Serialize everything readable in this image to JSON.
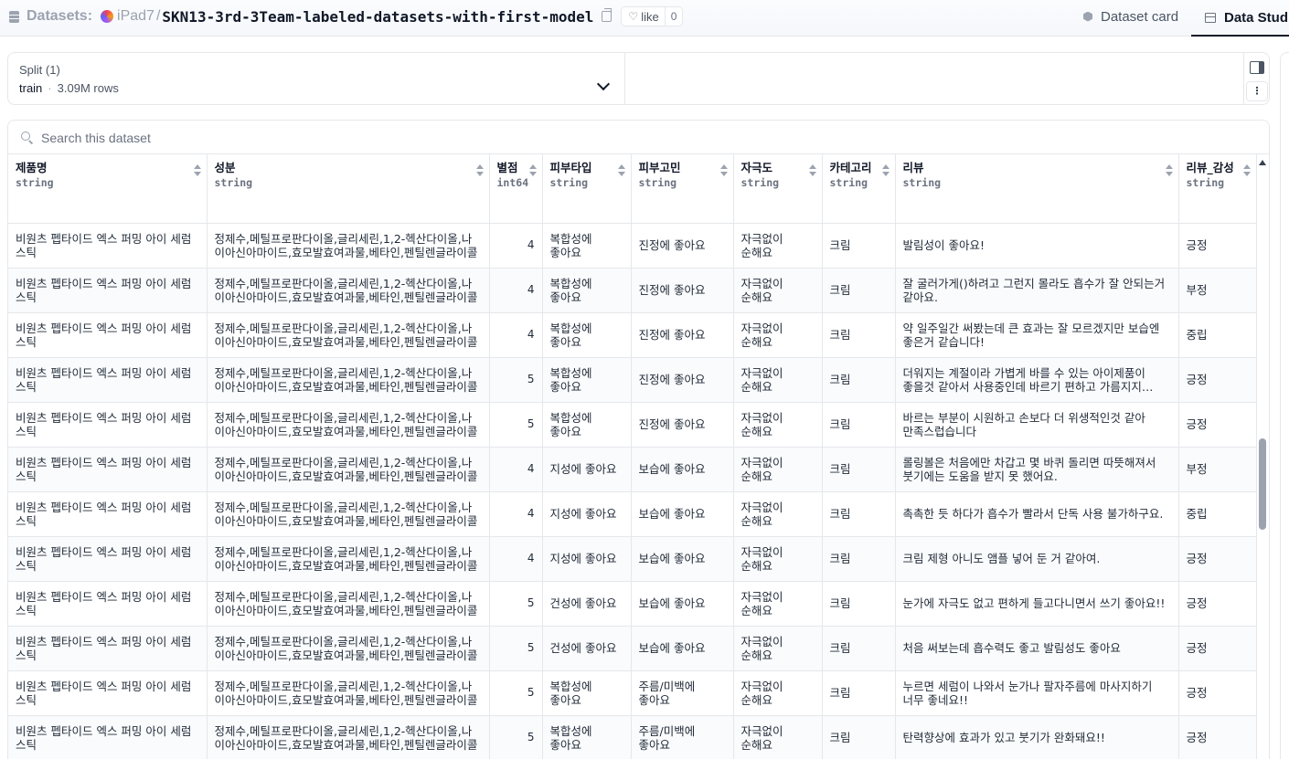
{
  "header": {
    "section": "Datasets:",
    "owner": "iPad7",
    "separator": "/",
    "repo": "SKN13-3rd-3Team-labeled-datasets-with-first-model",
    "like_label": "like",
    "like_count": "0",
    "tabs": [
      "Dataset card",
      "Data Studio"
    ]
  },
  "split": {
    "title": "Split (1)",
    "value": "train",
    "dot": "·",
    "rows": "3.09M rows"
  },
  "search": {
    "placeholder": "Search this dataset"
  },
  "table": {
    "columns": [
      {
        "name": "제품명",
        "type": "string"
      },
      {
        "name": "성분",
        "type": "string"
      },
      {
        "name": "별점",
        "type": "int64"
      },
      {
        "name": "피부타입",
        "type": "string"
      },
      {
        "name": "피부고민",
        "type": "string"
      },
      {
        "name": "자극도",
        "type": "string"
      },
      {
        "name": "카테고리",
        "type": "string"
      },
      {
        "name": "리뷰",
        "type": "string"
      },
      {
        "name": "리뷰_감성",
        "type": "string"
      }
    ],
    "rows": [
      [
        "비원츠 펩타이드 엑스 퍼밍 아이 세럼 스틱",
        "정제수,메틸프로판다이올,글리세린,1,2-헥산다이올,나이아신아마이드,효모발효여과물,베타인,펜틸렌글라이콜",
        "4",
        "복합성에 좋아요",
        "진정에 좋아요",
        "자극없이 순해요",
        "크림",
        "발림성이 좋아요!",
        "긍정"
      ],
      [
        "비원츠 펩타이드 엑스 퍼밍 아이 세럼 스틱",
        "정제수,메틸프로판다이올,글리세린,1,2-헥산다이올,나이아신아마이드,효모발효여과물,베타인,펜틸렌글라이콜",
        "4",
        "복합성에 좋아요",
        "진정에 좋아요",
        "자극없이 순해요",
        "크림",
        "잘 굴러가게()하려고 그런지 몰라도 흡수가 잘 안되는거 같아요.",
        "부정"
      ],
      [
        "비원츠 펩타이드 엑스 퍼밍 아이 세럼 스틱",
        "정제수,메틸프로판다이올,글리세린,1,2-헥산다이올,나이아신아마이드,효모발효여과물,베타인,펜틸렌글라이콜",
        "4",
        "복합성에 좋아요",
        "진정에 좋아요",
        "자극없이 순해요",
        "크림",
        "약 일주일간 써봤는데 큰 효과는 잘 모르겠지만 보습엔 좋은거 같습니다!",
        "중립"
      ],
      [
        "비원츠 펩타이드 엑스 퍼밍 아이 세럼 스틱",
        "정제수,메틸프로판다이올,글리세린,1,2-헥산다이올,나이아신아마이드,효모발효여과물,베타인,펜틸렌글라이콜",
        "5",
        "복합성에 좋아요",
        "진정에 좋아요",
        "자극없이 순해요",
        "크림",
        "더워지는 계절이라 가볍게 바를 수 있는 아이제품이 좋을것 같아서 사용중인데 바르기 편하고 가름지지 않아서 좋아요",
        "긍정"
      ],
      [
        "비원츠 펩타이드 엑스 퍼밍 아이 세럼 스틱",
        "정제수,메틸프로판다이올,글리세린,1,2-헥산다이올,나이아신아마이드,효모발효여과물,베타인,펜틸렌글라이콜",
        "5",
        "복합성에 좋아요",
        "진정에 좋아요",
        "자극없이 순해요",
        "크림",
        "바르는 부분이 시원하고 손보다 더 위생적인것 같아 만족스럽습니다",
        "긍정"
      ],
      [
        "비원츠 펩타이드 엑스 퍼밍 아이 세럼 스틱",
        "정제수,메틸프로판다이올,글리세린,1,2-헥산다이올,나이아신아마이드,효모발효여과물,베타인,펜틸렌글라이콜",
        "4",
        "지성에 좋아요",
        "보습에 좋아요",
        "자극없이 순해요",
        "크림",
        "롤링볼은 처음에만 차갑고 몇 바퀴 돌리면 따뜻해져서 붓기에는 도움을 받지 못 했어요.",
        "부정"
      ],
      [
        "비원츠 펩타이드 엑스 퍼밍 아이 세럼 스틱",
        "정제수,메틸프로판다이올,글리세린,1,2-헥산다이올,나이아신아마이드,효모발효여과물,베타인,펜틸렌글라이콜",
        "4",
        "지성에 좋아요",
        "보습에 좋아요",
        "자극없이 순해요",
        "크림",
        "촉촉한 듯 하다가 흡수가 빨라서 단독 사용 불가하구요.",
        "중립"
      ],
      [
        "비원츠 펩타이드 엑스 퍼밍 아이 세럼 스틱",
        "정제수,메틸프로판다이올,글리세린,1,2-헥산다이올,나이아신아마이드,효모발효여과물,베타인,펜틸렌글라이콜",
        "4",
        "지성에 좋아요",
        "보습에 좋아요",
        "자극없이 순해요",
        "크림",
        "크림 제형 아니도 앰플 넣어 둔 거 같아여.",
        "긍정"
      ],
      [
        "비원츠 펩타이드 엑스 퍼밍 아이 세럼 스틱",
        "정제수,메틸프로판다이올,글리세린,1,2-헥산다이올,나이아신아마이드,효모발효여과물,베타인,펜틸렌글라이콜",
        "5",
        "건성에 좋아요",
        "보습에 좋아요",
        "자극없이 순해요",
        "크림",
        "눈가에 자극도 없고 편하게 들고다니면서 쓰기 좋아요!!",
        "긍정"
      ],
      [
        "비원츠 펩타이드 엑스 퍼밍 아이 세럼 스틱",
        "정제수,메틸프로판다이올,글리세린,1,2-헥산다이올,나이아신아마이드,효모발효여과물,베타인,펜틸렌글라이콜",
        "5",
        "건성에 좋아요",
        "보습에 좋아요",
        "자극없이 순해요",
        "크림",
        "처음 써보는데 흡수력도 좋고 발림성도 좋아요",
        "긍정"
      ],
      [
        "비원츠 펩타이드 엑스 퍼밍 아이 세럼 스틱",
        "정제수,메틸프로판다이올,글리세린,1,2-헥산다이올,나이아신아마이드,효모발효여과물,베타인,펜틸렌글라이콜",
        "5",
        "복합성에 좋아요",
        "주름/미백에 좋아요",
        "자극없이 순해요",
        "크림",
        "누르면 세럼이 나와서 눈가나 팔자주름에 마사지하기 너무 좋네요!!",
        "긍정"
      ],
      [
        "비원츠 펩타이드 엑스 퍼밍 아이 세럼 스틱",
        "정제수,메틸프로판다이올,글리세린,1,2-헥산다이올,나이아신아마이드,효모발효여과물,베타인,펜틸렌글라이콜",
        "5",
        "복합성에 좋아요",
        "주름/미백에 좋아요",
        "자극없이 순해요",
        "크림",
        "탄력향상에 효과가 있고 붓기가 완화돼요!!",
        "긍정"
      ]
    ]
  }
}
